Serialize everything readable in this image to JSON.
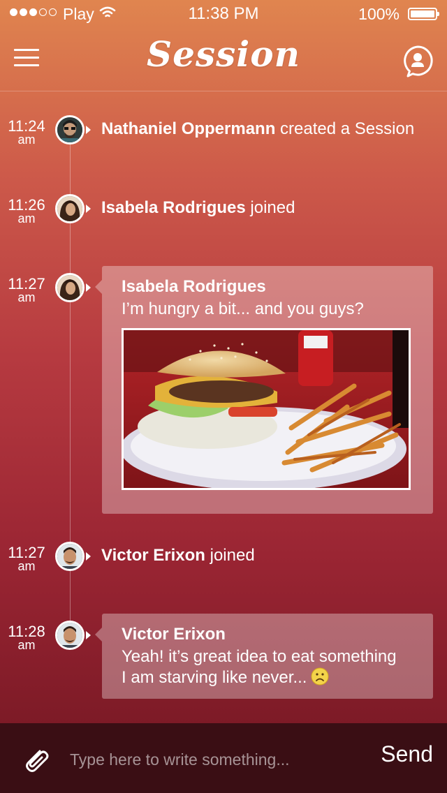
{
  "status_bar": {
    "carrier": "Play",
    "time": "11:38 PM",
    "battery": "100%"
  },
  "nav": {
    "title": "Session"
  },
  "timeline": [
    {
      "type": "event",
      "hm": "11:24",
      "ampm": "am",
      "who": "Nathaniel Oppermann",
      "action": "created a Session"
    },
    {
      "type": "event",
      "hm": "11:26",
      "ampm": "am",
      "who": "Isabela Rodrigues",
      "action": "joined"
    },
    {
      "type": "message",
      "hm": "11:27",
      "ampm": "am",
      "author": "Isabela Rodrigues",
      "text": "I’m hungry a bit... and you guys?",
      "attachment": "burger-fries-photo"
    },
    {
      "type": "event",
      "hm": "11:27",
      "ampm": "am",
      "who": "Victor Erixon",
      "action": "joined"
    },
    {
      "type": "message",
      "hm": "11:28",
      "ampm": "am",
      "author": "Victor Erixon",
      "text_line1": "Yeah! it’s great idea to eat something",
      "text_line2": "I am starving like never...",
      "emoji": "frowning-face-emoji"
    }
  ],
  "composer": {
    "placeholder": "Type here to write something...",
    "send_label": "Send"
  }
}
